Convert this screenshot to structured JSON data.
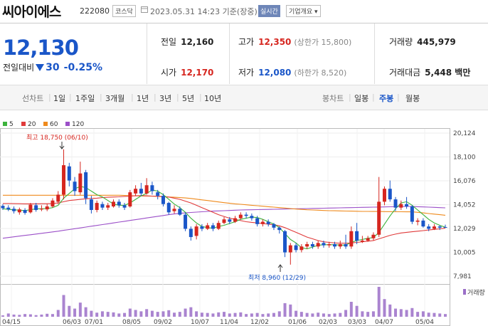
{
  "header": {
    "name": "씨아이에스",
    "code": "222080",
    "market": "코스닥",
    "datetime": "2023.05.31 14:23 기준(장중)",
    "live_label": "실시간",
    "corp_label": "기업개요 ▾"
  },
  "quote": {
    "price": "12,130",
    "change_label": "전일대비",
    "change": "30",
    "change_pct": "-0.25%",
    "prev_close_label": "전일",
    "prev_close": "12,160",
    "open_label": "시가",
    "open": "12,170",
    "high_label": "고가",
    "high": "12,350",
    "upper_limit": "(상한가 15,800)",
    "low_label": "저가",
    "low": "12,080",
    "lower_limit": "(하한가 8,520)",
    "volume_label": "거래량",
    "volume": "445,979",
    "amount_label": "거래대금",
    "amount": "5,448 백만"
  },
  "tabs": {
    "line_label": "선차트",
    "line_items": [
      "1일",
      "1주일",
      "3개월",
      "1년",
      "3년",
      "5년",
      "10년"
    ],
    "candle_label": "봉차트",
    "candle_items": [
      "일봉",
      "주봉",
      "월봉"
    ],
    "candle_active": "주봉"
  },
  "colors": {
    "up": "#d6261f",
    "down": "#1a56c8",
    "ma5": "#3cb33c",
    "ma20": "#e03a3a",
    "ma60": "#ef8a1c",
    "ma120": "#9b4fc8",
    "volume": "#9b6fc8"
  },
  "chart_data": {
    "type": "candlestick",
    "legend": [
      "5",
      "20",
      "60",
      "120"
    ],
    "y_ticks": [
      "20,124",
      "18,100",
      "16,076",
      "14,052",
      "12,029",
      "10,005",
      "7,981"
    ],
    "x_labels": [
      "04/15",
      "06/03",
      "07/01",
      "08/05",
      "09/02",
      "10/07",
      "11/04",
      "12/02",
      "01/06",
      "02/03",
      "03/03",
      "04/07",
      "05/04"
    ],
    "volume_label": "거래량",
    "high_annotation": "최고 18,750 (06/10)",
    "low_annotation": "최저 8,960 (12/29)",
    "ylim": [
      7981,
      20124
    ],
    "candles": [
      [
        13950,
        13750,
        14100,
        13600
      ],
      [
        13800,
        13650,
        14000,
        13500
      ],
      [
        13700,
        13500,
        13900,
        13300
      ],
      [
        13400,
        13650,
        13800,
        13200
      ],
      [
        13600,
        13350,
        13750,
        13200
      ],
      [
        13400,
        14050,
        14200,
        13300
      ],
      [
        14000,
        13600,
        14200,
        13450
      ],
      [
        13650,
        13700,
        14000,
        13500
      ],
      [
        13650,
        13900,
        14100,
        13500
      ],
      [
        13900,
        14400,
        14600,
        13800
      ],
      [
        14300,
        14900,
        15200,
        14100
      ],
      [
        14900,
        17400,
        18750,
        14500
      ],
      [
        17300,
        16100,
        17600,
        15600
      ],
      [
        16000,
        15200,
        16400,
        14800
      ],
      [
        15100,
        16700,
        17700,
        14900
      ],
      [
        16800,
        14600,
        17000,
        14100
      ],
      [
        14500,
        13600,
        14800,
        13300
      ],
      [
        13600,
        14200,
        14400,
        13400
      ],
      [
        14100,
        13800,
        14300,
        13600
      ],
      [
        13800,
        14000,
        14200,
        13600
      ],
      [
        13900,
        14300,
        14500,
        13800
      ],
      [
        14300,
        14000,
        14500,
        13800
      ],
      [
        14000,
        13800,
        14200,
        13600
      ],
      [
        13900,
        15100,
        15300,
        13800
      ],
      [
        15000,
        15400,
        15700,
        14800
      ],
      [
        15400,
        15000,
        15900,
        14800
      ],
      [
        15000,
        15700,
        16300,
        14900
      ],
      [
        15700,
        15200,
        16000,
        14900
      ],
      [
        15100,
        14800,
        15300,
        14500
      ],
      [
        14800,
        14100,
        15000,
        13900
      ],
      [
        14200,
        13400,
        14300,
        13200
      ],
      [
        13500,
        13700,
        14000,
        13300
      ],
      [
        13700,
        13200,
        13900,
        13100
      ],
      [
        13200,
        12000,
        13400,
        11800
      ],
      [
        12000,
        11300,
        12200,
        11000
      ],
      [
        11400,
        12200,
        12400,
        11100
      ],
      [
        12200,
        12000,
        12400,
        11800
      ],
      [
        12000,
        12300,
        12500,
        11900
      ],
      [
        12300,
        12000,
        12500,
        11800
      ],
      [
        12000,
        12500,
        12700,
        11900
      ],
      [
        12500,
        12800,
        13000,
        12400
      ],
      [
        12800,
        12600,
        13000,
        12400
      ],
      [
        12600,
        12900,
        13100,
        12500
      ],
      [
        12900,
        13200,
        13400,
        12800
      ],
      [
        13200,
        13100,
        13400,
        12900
      ],
      [
        13100,
        12900,
        13300,
        12700
      ],
      [
        12900,
        12400,
        13100,
        12200
      ],
      [
        12400,
        12600,
        12800,
        12200
      ],
      [
        12600,
        12400,
        12800,
        12200
      ],
      [
        12400,
        12100,
        12500,
        11900
      ],
      [
        12100,
        11900,
        12200,
        11600
      ],
      [
        11800,
        10000,
        11900,
        9600
      ],
      [
        10000,
        10600,
        10800,
        8960
      ],
      [
        10600,
        10200,
        10800,
        10000
      ],
      [
        10200,
        10500,
        10700,
        10000
      ],
      [
        10500,
        10700,
        10900,
        10300
      ],
      [
        10700,
        10500,
        10900,
        10300
      ],
      [
        10500,
        10800,
        11000,
        10300
      ],
      [
        10800,
        10600,
        11000,
        10400
      ],
      [
        10600,
        10700,
        10900,
        10400
      ],
      [
        10700,
        10500,
        10900,
        10300
      ],
      [
        10500,
        10700,
        11000,
        10300
      ],
      [
        10700,
        10500,
        11500,
        10300
      ],
      [
        10500,
        11800,
        12200,
        10300
      ],
      [
        11800,
        11000,
        12500,
        10700
      ],
      [
        10900,
        11000,
        11400,
        10800
      ],
      [
        11000,
        11200,
        11400,
        10900
      ],
      [
        11200,
        11500,
        11700,
        11000
      ],
      [
        11500,
        14300,
        16400,
        11300
      ],
      [
        14300,
        15400,
        15600,
        14000
      ],
      [
        15400,
        14500,
        16100,
        14300
      ],
      [
        14500,
        13800,
        14700,
        13500
      ],
      [
        13800,
        14100,
        14400,
        13600
      ],
      [
        14100,
        13900,
        14700,
        13700
      ],
      [
        13900,
        12600,
        14000,
        12400
      ],
      [
        12600,
        12700,
        12900,
        12300
      ],
      [
        12700,
        12200,
        12900,
        12100
      ],
      [
        12200,
        12000,
        12400,
        11800
      ],
      [
        12000,
        12200,
        12400,
        11900
      ],
      [
        12200,
        12100,
        12300,
        11900
      ],
      [
        12150,
        12130,
        12350,
        12080
      ]
    ],
    "volume": [
      5,
      12,
      8,
      7,
      10,
      9,
      6,
      8,
      11,
      10,
      25,
      80,
      40,
      30,
      52,
      35,
      22,
      15,
      20,
      18,
      16,
      12,
      14,
      30,
      25,
      20,
      28,
      22,
      18,
      20,
      24,
      15,
      18,
      30,
      35,
      20,
      15,
      14,
      12,
      16,
      18,
      12,
      14,
      16,
      10,
      12,
      14,
      10,
      12,
      14,
      20,
      50,
      45,
      22,
      18,
      14,
      12,
      15,
      12,
      10,
      12,
      14,
      25,
      55,
      40,
      20,
      18,
      20,
      110,
      65,
      45,
      30,
      28,
      25,
      32,
      18,
      20,
      15,
      14,
      12,
      10
    ],
    "ma5": [
      13700,
      13650,
      13620,
      13580,
      13550,
      13620,
      13700,
      13700,
      13720,
      13800,
      14000,
      14600,
      15000,
      15400,
      15600,
      15500,
      15200,
      14900,
      14700,
      14400,
      14100,
      14000,
      14000,
      14200,
      14500,
      14800,
      15000,
      15300,
      15200,
      14900,
      14500,
      14100,
      13800,
      13400,
      12900,
      12500,
      12200,
      12100,
      12050,
      12200,
      12300,
      12450,
      12600,
      12800,
      12900,
      13000,
      12950,
      12800,
      12600,
      12400,
      12100,
      11600,
      11100,
      10800,
      10400,
      10300,
      10450,
      10600,
      10650,
      10650,
      10650,
      10620,
      10620,
      10850,
      11000,
      11100,
      11200,
      11250,
      11700,
      12400,
      13100,
      13700,
      14200,
      14300,
      14000,
      13600,
      13200,
      12800,
      12500,
      12300,
      12130
    ],
    "ma20": [
      14150,
      14150,
      14140,
      14130,
      14120,
      14120,
      14120,
      14130,
      14130,
      14150,
      14200,
      14300,
      14400,
      14450,
      14500,
      14550,
      14580,
      14600,
      14650,
      14680,
      14700,
      14720,
      14750,
      14780,
      14800,
      14820,
      14800,
      14780,
      14760,
      14740,
      14700,
      14600,
      14500,
      14350,
      14200,
      14000,
      13800,
      13600,
      13400,
      13200,
      13050,
      12900,
      12800,
      12700,
      12600,
      12550,
      12500,
      12450,
      12400,
      12350,
      12250,
      12100,
      11900,
      11700,
      11500,
      11300,
      11150,
      11000,
      10900,
      10850,
      10800,
      10780,
      10780,
      10800,
      10850,
      10900,
      10950,
      11000,
      11150,
      11300,
      11450,
      11550,
      11650,
      11700,
      11750,
      11800,
      11850,
      11900,
      11950,
      12000,
      12050
    ],
    "ma60": [
      14850,
      14850,
      14850,
      14850,
      14850,
      14850,
      14850,
      14850,
      14850,
      14850,
      14850,
      14850,
      14850,
      14850,
      14850,
      14850,
      14850,
      14850,
      14850,
      14850,
      14850,
      14850,
      14830,
      14810,
      14800,
      14790,
      14780,
      14770,
      14750,
      14720,
      14700,
      14680,
      14650,
      14620,
      14580,
      14520,
      14460,
      14400,
      14340,
      14280,
      14220,
      14170,
      14120,
      14080,
      14040,
      14000,
      13960,
      13920,
      13880,
      13840,
      13800,
      13760,
      13720,
      13680,
      13650,
      13620,
      13600,
      13580,
      13560,
      13540,
      13530,
      13520,
      13510,
      13500,
      13490,
      13480,
      13480,
      13470,
      13470,
      13460,
      13460,
      13450,
      13450,
      13440,
      13440,
      13400,
      13350,
      13300,
      13250,
      13200,
      13150
    ],
    "ma120": [
      11200,
      11260,
      11320,
      11380,
      11440,
      11500,
      11560,
      11620,
      11680,
      11740,
      11800,
      11870,
      11940,
      12010,
      12080,
      12150,
      12220,
      12290,
      12360,
      12430,
      12500,
      12570,
      12640,
      12710,
      12780,
      12850,
      12920,
      12990,
      13060,
      13130,
      13200,
      13260,
      13310,
      13350,
      13390,
      13420,
      13450,
      13480,
      13500,
      13520,
      13540,
      13560,
      13580,
      13600,
      13610,
      13620,
      13630,
      13640,
      13650,
      13660,
      13670,
      13680,
      13690,
      13700,
      13710,
      13720,
      13730,
      13740,
      13750,
      13760,
      13770,
      13780,
      13790,
      13800,
      13810,
      13820,
      13830,
      13840,
      13850,
      13860,
      13870,
      13880,
      13890,
      13900,
      13900,
      13880,
      13860,
      13840,
      13820,
      13800,
      13780
    ]
  }
}
